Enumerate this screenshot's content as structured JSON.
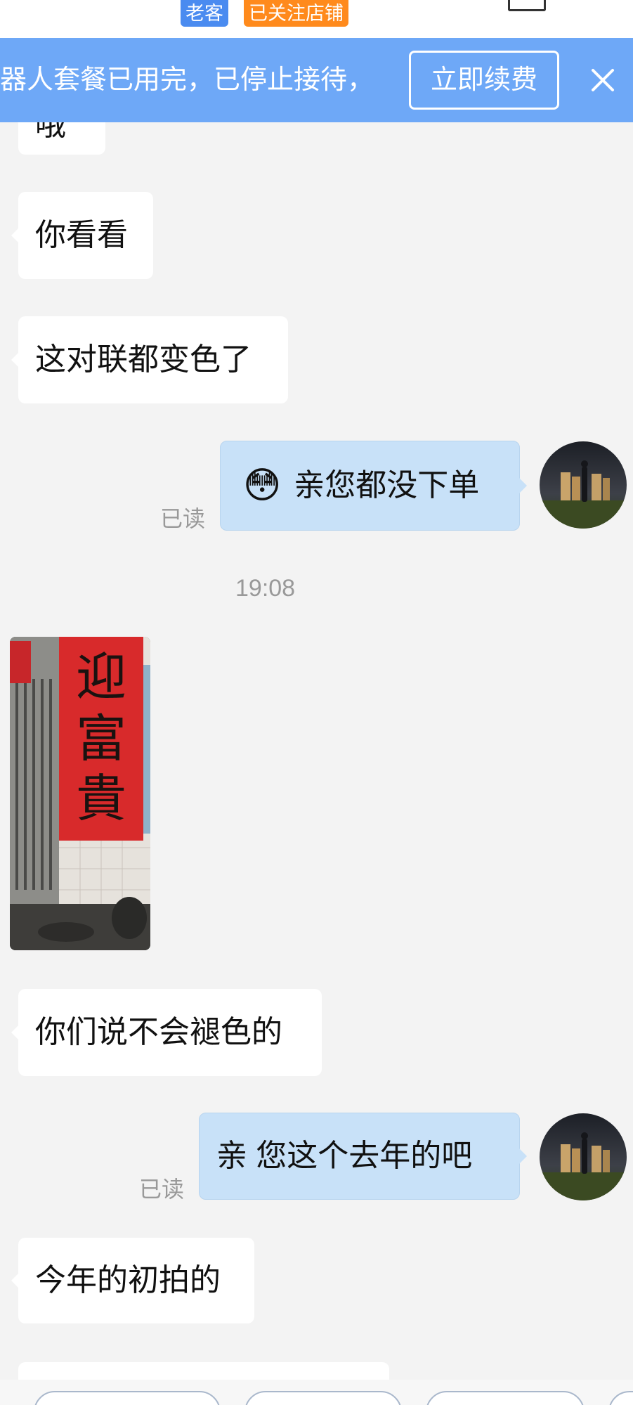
{
  "top": {
    "tag_old_customer": "老客",
    "tag_followed_store": "已关注店铺"
  },
  "banner": {
    "text": "器人套餐已用完，已停止接待，",
    "renew_button": "立即续费",
    "close_icon": "close-icon",
    "bg_color": "#6ea8f7"
  },
  "messages": [
    {
      "side": "left",
      "text": "哦"
    },
    {
      "side": "left",
      "text": "你看看"
    },
    {
      "side": "left",
      "text": "这对联都变色了"
    },
    {
      "side": "right",
      "text": "亲您都没下单",
      "emoji": "😳",
      "status": "已读"
    },
    {
      "type": "time",
      "text": "19:08"
    },
    {
      "side": "left",
      "type": "image",
      "image_chars": [
        "迎",
        "富",
        "貴"
      ]
    },
    {
      "side": "left",
      "text": "你们说不会褪色的"
    },
    {
      "side": "right",
      "text": "亲 您这个去年的吧",
      "status": "已读"
    },
    {
      "side": "left",
      "text": "今年的初拍的"
    }
  ],
  "colors": {
    "background": "#f3f3f3",
    "bubble_left": "#ffffff",
    "bubble_right": "#c8e1f8",
    "read_text": "#999999",
    "tag_old": "#4a8bf0",
    "tag_follow": "#ff8a1c"
  }
}
